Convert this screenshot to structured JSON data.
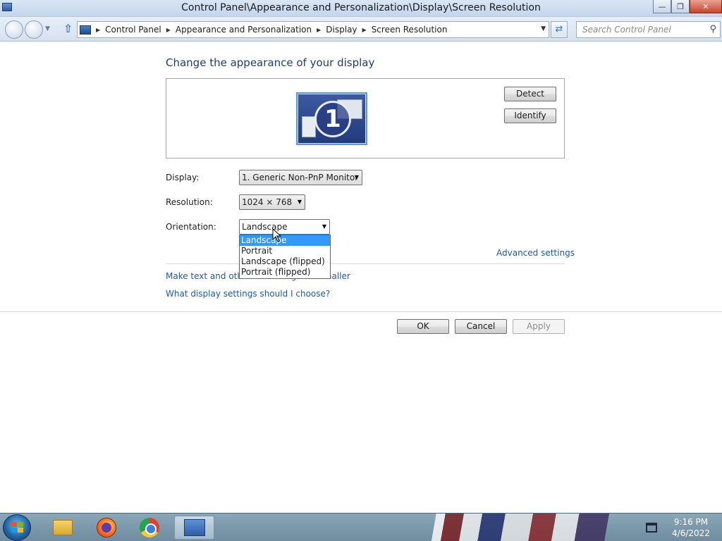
{
  "window": {
    "title": "Control Panel\\Appearance and Personalization\\Display\\Screen Resolution",
    "minimize": "—",
    "restore": "❐",
    "close": "✕"
  },
  "address_bar": {
    "breadcrumbs": [
      "Control Panel",
      "Appearance and Personalization",
      "Display",
      "Screen Resolution"
    ],
    "search_placeholder": "Search Control Panel"
  },
  "content": {
    "heading": "Change the appearance of your display",
    "monitor_number": "1",
    "detect_label": "Detect",
    "identify_label": "Identify",
    "display_label": "Display:",
    "display_value": "1. Generic Non-PnP Monitor",
    "resolution_label": "Resolution:",
    "resolution_value": "1024 × 768",
    "orientation_label": "Orientation:",
    "orientation_value": "Landscape",
    "orientation_options": [
      "Landscape",
      "Portrait",
      "Landscape (flipped)",
      "Portrait (flipped)"
    ],
    "orientation_selected_index": 0,
    "advanced_link": "Advanced settings",
    "text_size_link": "Make text and other items larger or smaller",
    "help_link": "What display settings should I choose?",
    "ok_label": "OK",
    "cancel_label": "Cancel",
    "apply_label": "Apply"
  },
  "taskbar": {
    "items": [
      "start-orb",
      "file-explorer-icon",
      "firefox-icon",
      "chrome-icon",
      "control-panel-icon"
    ],
    "active_item": "control-panel-icon",
    "clock_time": "9:16 PM",
    "clock_date": "4/6/2022"
  },
  "colors": {
    "heading": "#1e3d78",
    "link": "#1e5aa8",
    "selection": "#3399ff"
  }
}
